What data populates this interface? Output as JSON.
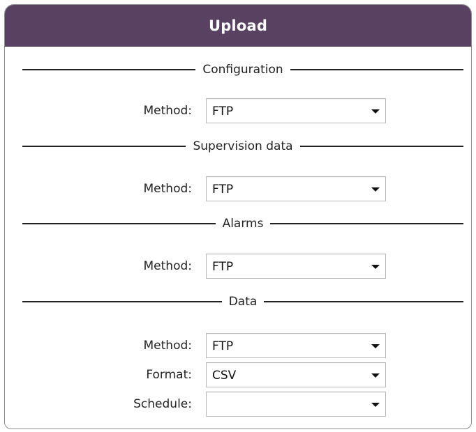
{
  "panel": {
    "title": "Upload",
    "header_color": "#584161"
  },
  "sections": [
    {
      "title": "Configuration",
      "fields": [
        {
          "label": "Method:",
          "value": "FTP",
          "icon": "chevron-down-icon"
        }
      ]
    },
    {
      "title": "Supervision data",
      "fields": [
        {
          "label": "Method:",
          "value": "FTP",
          "icon": "chevron-down-icon"
        }
      ]
    },
    {
      "title": "Alarms",
      "fields": [
        {
          "label": "Method:",
          "value": "FTP",
          "icon": "chevron-down-icon"
        }
      ]
    },
    {
      "title": "Data",
      "fields": [
        {
          "label": "Method:",
          "value": "FTP",
          "icon": "chevron-down-icon"
        },
        {
          "label": "Format:",
          "value": "CSV",
          "icon": "chevron-down-icon"
        },
        {
          "label": "Schedule:",
          "value": "",
          "icon": "chevron-down-icon"
        }
      ]
    }
  ]
}
